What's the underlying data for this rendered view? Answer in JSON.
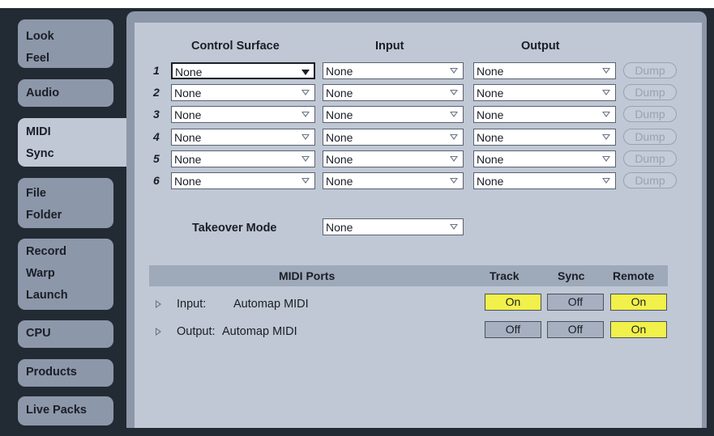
{
  "sidebar": {
    "tabs": [
      {
        "lines": [
          "Look",
          "Feel"
        ]
      },
      {
        "lines": [
          "Audio"
        ]
      },
      {
        "lines": [
          "MIDI",
          "Sync"
        ]
      },
      {
        "lines": [
          "File",
          "Folder"
        ]
      },
      {
        "lines": [
          "Record",
          "Warp",
          "Launch"
        ]
      },
      {
        "lines": [
          "CPU"
        ]
      },
      {
        "lines": [
          "Products"
        ]
      },
      {
        "lines": [
          "Live Packs"
        ]
      }
    ],
    "active": "MIDI Sync"
  },
  "surfaces": {
    "headers": {
      "control_surface": "Control Surface",
      "input": "Input",
      "output": "Output"
    },
    "rows": [
      {
        "num": "1",
        "control": "None",
        "input": "None",
        "output": "None",
        "dump": "Dump"
      },
      {
        "num": "2",
        "control": "None",
        "input": "None",
        "output": "None",
        "dump": "Dump"
      },
      {
        "num": "3",
        "control": "None",
        "input": "None",
        "output": "None",
        "dump": "Dump"
      },
      {
        "num": "4",
        "control": "None",
        "input": "None",
        "output": "None",
        "dump": "Dump"
      },
      {
        "num": "5",
        "control": "None",
        "input": "None",
        "output": "None",
        "dump": "Dump"
      },
      {
        "num": "6",
        "control": "None",
        "input": "None",
        "output": "None",
        "dump": "Dump"
      }
    ]
  },
  "takeover": {
    "label": "Takeover Mode",
    "value": "None"
  },
  "midi_ports": {
    "headers": {
      "ports": "MIDI Ports",
      "track": "Track",
      "sync": "Sync",
      "remote": "Remote"
    },
    "rows": [
      {
        "direction": "Input:",
        "device": "Automap MIDI",
        "track": "On",
        "sync": "Off",
        "remote": "On"
      },
      {
        "direction": "Output:",
        "device": "Automap MIDI",
        "track": "Off",
        "sync": "Off",
        "remote": "On"
      }
    ]
  },
  "colors": {
    "on": "#f2f04a",
    "off": "#a6b0c0",
    "panel": "#bfc8d4"
  }
}
